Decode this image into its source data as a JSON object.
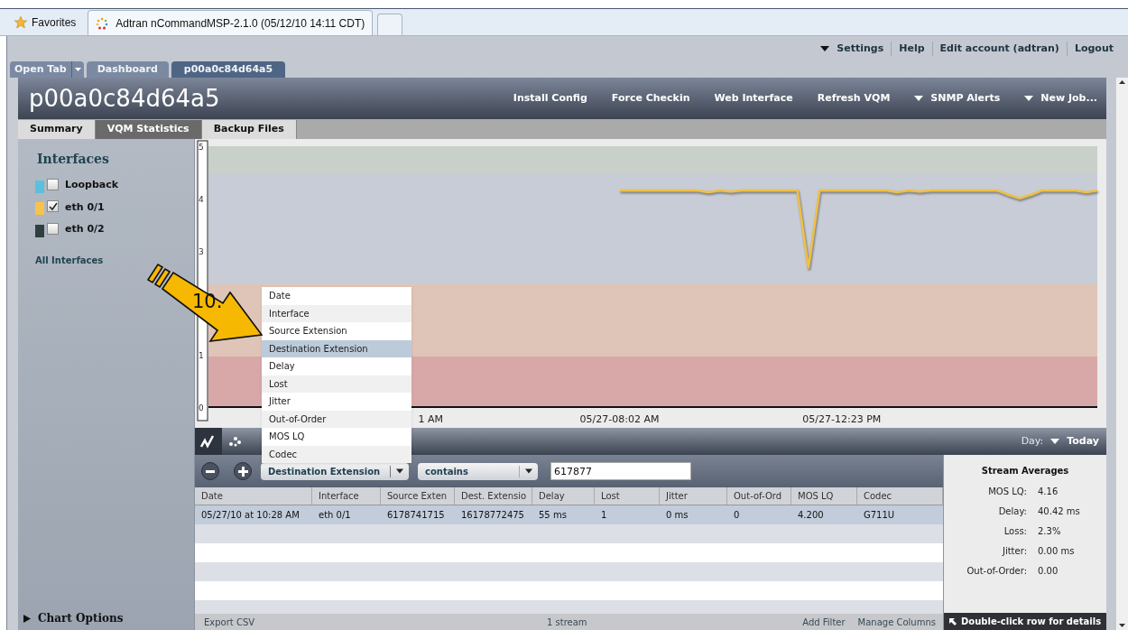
{
  "browser": {
    "favorites": "Favorites",
    "tabs": [
      {
        "label": "Adtran nCommandMSP-2.1.0 (05/12/10 14:11 CDT)",
        "selected": true
      }
    ]
  },
  "top_links": [
    {
      "label": "Settings",
      "dropdown": true
    },
    {
      "label": "Help",
      "dropdown": false
    },
    {
      "label": "Edit account (adtran)",
      "dropdown": false
    },
    {
      "label": "Logout",
      "dropdown": false
    }
  ],
  "app_tabs": [
    {
      "label": "Open Tab",
      "kind": "menu",
      "selected": false
    },
    {
      "label": "Dashboard",
      "kind": "tab",
      "selected": false
    },
    {
      "label": "p00a0c84d64a5",
      "kind": "tab",
      "selected": true
    }
  ],
  "device": {
    "title": "p00a0c84d64a5",
    "actions": [
      {
        "label": "Install Config",
        "dropdown": false
      },
      {
        "label": "Force Checkin",
        "dropdown": false
      },
      {
        "label": "Web Interface",
        "dropdown": false
      },
      {
        "label": "Refresh VQM",
        "dropdown": false
      },
      {
        "label": "SNMP Alerts",
        "dropdown": true
      },
      {
        "label": "New Job...",
        "dropdown": true
      }
    ]
  },
  "sub_tabs": [
    {
      "label": "Summary",
      "selected": false
    },
    {
      "label": "VQM Statistics",
      "selected": true
    },
    {
      "label": "Backup Files",
      "selected": false
    }
  ],
  "sidebar": {
    "title": "Interfaces",
    "interfaces": [
      {
        "label": "Loopback",
        "color": "#5bc0de",
        "checked": false
      },
      {
        "label": "eth 0/1",
        "color": "#f7c34a",
        "checked": true
      },
      {
        "label": "eth 0/2",
        "color": "#2f3f40",
        "checked": false
      }
    ],
    "all_link": "All Interfaces",
    "chart_options": "Chart Options"
  },
  "chart": {
    "chart_data": {
      "type": "line",
      "ylim": [
        0,
        5
      ],
      "yticks": [
        0,
        1,
        3,
        4,
        5
      ],
      "categories": [
        null,
        null,
        null,
        null,
        null,
        null,
        null,
        null,
        null,
        null,
        null,
        null,
        null,
        null,
        null,
        null,
        null,
        null,
        null,
        null,
        "1 AM",
        null,
        null,
        null,
        null,
        null,
        null,
        null,
        null,
        null,
        null,
        null,
        null,
        null,
        null,
        null,
        null,
        "05/27-08:02 AM",
        null,
        null,
        null,
        null,
        null,
        null,
        null,
        null,
        null,
        null,
        null,
        null,
        null,
        null,
        null,
        null,
        null,
        null,
        null,
        "05/27-12:23 PM",
        null,
        null,
        null,
        null,
        null,
        null,
        null,
        null,
        null,
        null,
        null,
        null,
        null,
        null,
        null,
        null,
        null,
        null,
        null,
        null,
        null,
        null,
        null
      ],
      "series": [
        {
          "color": "#f0c040",
          "values": [
            null,
            null,
            null,
            null,
            null,
            null,
            null,
            null,
            null,
            null,
            null,
            null,
            null,
            null,
            null,
            null,
            null,
            null,
            null,
            null,
            null,
            null,
            null,
            null,
            null,
            null,
            null,
            null,
            null,
            null,
            null,
            null,
            null,
            null,
            null,
            null,
            null,
            4.15,
            4.15,
            4.15,
            4.15,
            4.15,
            4.15,
            4.15,
            4.15,
            4.12,
            4.15,
            4.13,
            4.15,
            4.15,
            4.15,
            4.15,
            4.15,
            4.15,
            2.66,
            4.15,
            4.15,
            4.15,
            4.15,
            4.15,
            4.15,
            4.15,
            4.12,
            4.15,
            4.13,
            4.15,
            4.15,
            4.15,
            4.15,
            4.15,
            4.15,
            4.15,
            4.07,
            4.0,
            4.07,
            4.15,
            4.15,
            4.15,
            4.15,
            4.12,
            4.15
          ]
        }
      ]
    }
  },
  "chart_toolbar": {
    "day_label": "Day:",
    "day_value": "Today"
  },
  "filter": {
    "field": "Destination Extension",
    "operator": "contains",
    "value": "617877"
  },
  "dropdown": {
    "options": [
      {
        "label": "Date",
        "selected": false
      },
      {
        "label": "Interface",
        "selected": false
      },
      {
        "label": "Source Extension",
        "selected": false
      },
      {
        "label": "Destination Extension",
        "selected": true
      },
      {
        "label": "Delay",
        "selected": false
      },
      {
        "label": "Lost",
        "selected": false
      },
      {
        "label": "Jitter",
        "selected": false
      },
      {
        "label": "Out-of-Order",
        "selected": false
      },
      {
        "label": "MOS LQ",
        "selected": false
      },
      {
        "label": "Codec",
        "selected": false
      }
    ]
  },
  "annotation": {
    "label": "10."
  },
  "table": {
    "columns": [
      "Date",
      "Interface",
      "Source Exten",
      "Dest. Extensio",
      "Delay",
      "Lost",
      "Jitter",
      "Out-of-Ord",
      "MOS LQ",
      "Codec"
    ],
    "rows": [
      {
        "selected": true,
        "cells": [
          "05/27/10 at 10:28 AM",
          "eth 0/1",
          "6178741715",
          "16178772475",
          "55 ms",
          "1",
          "0 ms",
          "0",
          "4.200",
          "G711U"
        ]
      }
    ]
  },
  "footer": {
    "export": "Export CSV",
    "count": "1 stream",
    "add_filter": "Add Filter",
    "manage_columns": "Manage Columns"
  },
  "stream_averages": {
    "title": "Stream Averages",
    "items": [
      {
        "label": "MOS LQ:",
        "value": "4.16"
      },
      {
        "label": "Delay:",
        "value": "40.42 ms"
      },
      {
        "label": "Loss:",
        "value": "2.3%"
      },
      {
        "label": "Jitter:",
        "value": "0.00 ms"
      },
      {
        "label": "Out-of-Order:",
        "value": "0.00"
      }
    ],
    "hint": "Double-click row for details"
  }
}
